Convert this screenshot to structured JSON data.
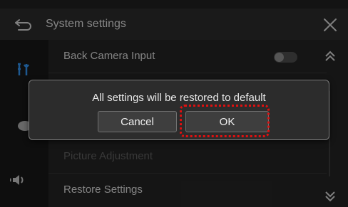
{
  "header": {
    "title": "System settings",
    "back_icon": "back-arrow-icon",
    "close_icon": "close-icon"
  },
  "sidebar": {
    "items": [
      {
        "icon": "tools-icon",
        "selected": true
      },
      {
        "icon": "display-icon",
        "selected": false
      },
      {
        "icon": "speaker-icon",
        "selected": false
      }
    ],
    "accent": "#2f8fe8"
  },
  "list": {
    "rows": [
      {
        "label": "Back Camera Input",
        "toggle": false
      },
      {
        "label": ""
      },
      {
        "label": ""
      },
      {
        "label": "Picture Adjustment",
        "disabled": true
      },
      {
        "label": "Restore Settings"
      }
    ]
  },
  "dialog": {
    "message": "All settings will be restored to default",
    "cancel_label": "Cancel",
    "ok_label": "OK"
  },
  "highlight_color": "#e01010"
}
